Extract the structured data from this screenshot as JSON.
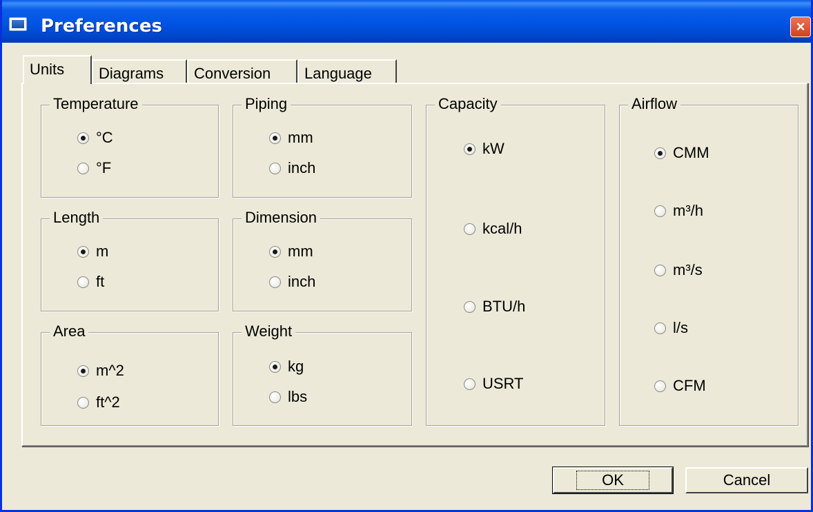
{
  "window": {
    "title": "Preferences",
    "close_icon": "×"
  },
  "tabs": [
    {
      "label": "Units",
      "active": true
    },
    {
      "label": "Diagrams",
      "active": false
    },
    {
      "label": "Conversion",
      "active": false
    },
    {
      "label": "Language",
      "active": false
    }
  ],
  "groups": {
    "temperature": {
      "label": "Temperature",
      "options": [
        "°C",
        "°F"
      ],
      "selected": "°C"
    },
    "piping": {
      "label": "Piping",
      "options": [
        "mm",
        "inch"
      ],
      "selected": "mm"
    },
    "length": {
      "label": "Length",
      "options": [
        "m",
        "ft"
      ],
      "selected": "m"
    },
    "dimension": {
      "label": "Dimension",
      "options": [
        "mm",
        "inch"
      ],
      "selected": "mm"
    },
    "area": {
      "label": "Area",
      "options": [
        "m^2",
        "ft^2"
      ],
      "selected": "m^2"
    },
    "weight": {
      "label": "Weight",
      "options": [
        "kg",
        "lbs"
      ],
      "selected": "kg"
    },
    "capacity": {
      "label": "Capacity",
      "options": [
        "kW",
        "kcal/h",
        "BTU/h",
        "USRT"
      ],
      "selected": "kW"
    },
    "airflow": {
      "label": "Airflow",
      "options": [
        "CMM",
        "m³/h",
        "m³/s",
        "l/s",
        "CFM"
      ],
      "selected": "CMM"
    }
  },
  "buttons": {
    "ok": "OK",
    "cancel": "Cancel"
  }
}
